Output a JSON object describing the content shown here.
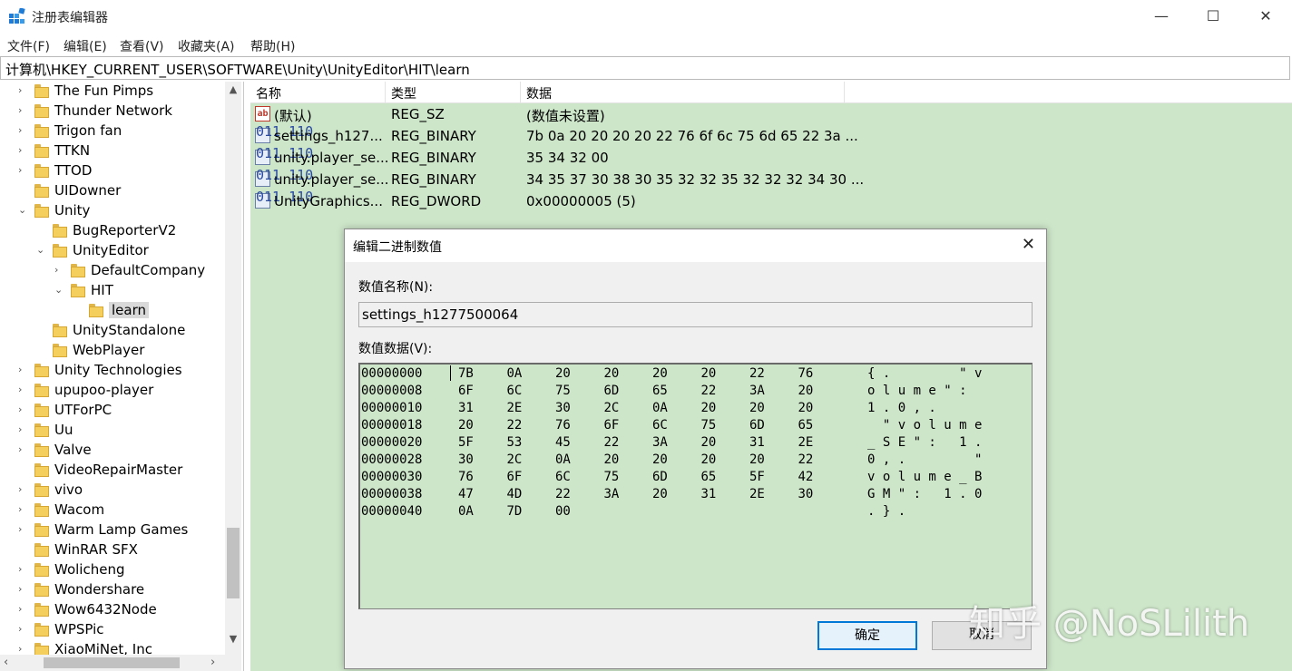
{
  "window": {
    "title": "注册表编辑器",
    "controls": [
      "—",
      "☐",
      "✕"
    ]
  },
  "menu": [
    "文件(F)",
    "编辑(E)",
    "查看(V)",
    "收藏夹(A)",
    "帮助(H)"
  ],
  "address": "计算机\\HKEY_CURRENT_USER\\SOFTWARE\\Unity\\UnityEditor\\HIT\\learn",
  "tree": {
    "items": [
      {
        "label": "The Fun Pimps",
        "depth": 0,
        "expander": "›"
      },
      {
        "label": "Thunder Network",
        "depth": 0,
        "expander": "›"
      },
      {
        "label": "Trigon fan",
        "depth": 0,
        "expander": "›"
      },
      {
        "label": "TTKN",
        "depth": 0,
        "expander": "›"
      },
      {
        "label": "TTOD",
        "depth": 0,
        "expander": "›"
      },
      {
        "label": "UIDowner",
        "depth": 0,
        "expander": ""
      },
      {
        "label": "Unity",
        "depth": 0,
        "expander": "⌄"
      },
      {
        "label": "BugReporterV2",
        "depth": 1,
        "expander": ""
      },
      {
        "label": "UnityEditor",
        "depth": 1,
        "expander": "⌄"
      },
      {
        "label": "DefaultCompany",
        "depth": 2,
        "expander": "›"
      },
      {
        "label": "HIT",
        "depth": 2,
        "expander": "⌄"
      },
      {
        "label": "learn",
        "depth": 3,
        "expander": "",
        "selected": true
      },
      {
        "label": "UnityStandalone",
        "depth": 1,
        "expander": ""
      },
      {
        "label": "WebPlayer",
        "depth": 1,
        "expander": ""
      },
      {
        "label": "Unity Technologies",
        "depth": 0,
        "expander": "›"
      },
      {
        "label": "upupoo-player",
        "depth": 0,
        "expander": "›"
      },
      {
        "label": "UTForPC",
        "depth": 0,
        "expander": "›"
      },
      {
        "label": "Uu",
        "depth": 0,
        "expander": "›"
      },
      {
        "label": "Valve",
        "depth": 0,
        "expander": "›"
      },
      {
        "label": "VideoRepairMaster",
        "depth": 0,
        "expander": ""
      },
      {
        "label": "vivo",
        "depth": 0,
        "expander": "›"
      },
      {
        "label": "Wacom",
        "depth": 0,
        "expander": "›"
      },
      {
        "label": "Warm Lamp Games",
        "depth": 0,
        "expander": "›"
      },
      {
        "label": "WinRAR SFX",
        "depth": 0,
        "expander": ""
      },
      {
        "label": "Wolicheng",
        "depth": 0,
        "expander": "›"
      },
      {
        "label": "Wondershare",
        "depth": 0,
        "expander": "›"
      },
      {
        "label": "Wow6432Node",
        "depth": 0,
        "expander": "›"
      },
      {
        "label": "WPSPic",
        "depth": 0,
        "expander": "›"
      },
      {
        "label": "XiaoMiNet, Inc",
        "depth": 0,
        "expander": "›"
      }
    ]
  },
  "values": {
    "headers": [
      "名称",
      "类型",
      "数据"
    ],
    "rows": [
      {
        "icon": "string-value-icon",
        "name": "(默认)",
        "type": "REG_SZ",
        "data": "(数值未设置)"
      },
      {
        "icon": "binary-value-icon",
        "name": "settings_h127...",
        "type": "REG_BINARY",
        "data": "7b 0a 20 20 20 20 22 76 6f 6c 75 6d 65 22 3a ..."
      },
      {
        "icon": "binary-value-icon",
        "name": "unity.player_se...",
        "type": "REG_BINARY",
        "data": "35 34 32 00"
      },
      {
        "icon": "binary-value-icon",
        "name": "unity.player_se...",
        "type": "REG_BINARY",
        "data": "34 35 37 30 38 30 35 32 32 35 32 32 32 34 30 ..."
      },
      {
        "icon": "binary-value-icon",
        "name": "UnityGraphics...",
        "type": "REG_DWORD",
        "data": "0x00000005 (5)"
      }
    ]
  },
  "dialog": {
    "title": "编辑二进制数值",
    "name_label": "数值名称(N):",
    "name_value": "settings_h1277500064",
    "data_label": "数值数据(V):",
    "hex_rows": [
      {
        "offset": "00000000",
        "bytes": [
          "7B",
          "0A",
          "20",
          "20",
          "20",
          "20",
          "22",
          "76"
        ],
        "ascii": "{ .         \" v"
      },
      {
        "offset": "00000008",
        "bytes": [
          "6F",
          "6C",
          "75",
          "6D",
          "65",
          "22",
          "3A",
          "20"
        ],
        "ascii": "o l u m e \" :"
      },
      {
        "offset": "00000010",
        "bytes": [
          "31",
          "2E",
          "30",
          "2C",
          "0A",
          "20",
          "20",
          "20"
        ],
        "ascii": "1 . 0 , ."
      },
      {
        "offset": "00000018",
        "bytes": [
          "20",
          "22",
          "76",
          "6F",
          "6C",
          "75",
          "6D",
          "65"
        ],
        "ascii": "  \" v o l u m e"
      },
      {
        "offset": "00000020",
        "bytes": [
          "5F",
          "53",
          "45",
          "22",
          "3A",
          "20",
          "31",
          "2E"
        ],
        "ascii": "_ S E \" :   1 ."
      },
      {
        "offset": "00000028",
        "bytes": [
          "30",
          "2C",
          "0A",
          "20",
          "20",
          "20",
          "20",
          "22"
        ],
        "ascii": "0 , .         \""
      },
      {
        "offset": "00000030",
        "bytes": [
          "76",
          "6F",
          "6C",
          "75",
          "6D",
          "65",
          "5F",
          "42"
        ],
        "ascii": "v o l u m e _ B"
      },
      {
        "offset": "00000038",
        "bytes": [
          "47",
          "4D",
          "22",
          "3A",
          "20",
          "31",
          "2E",
          "30"
        ],
        "ascii": "G M \" :   1 . 0"
      },
      {
        "offset": "00000040",
        "bytes": [
          "0A",
          "7D",
          "00"
        ],
        "ascii": ". } ."
      }
    ],
    "ok_label": "确定",
    "cancel_label": "取消"
  },
  "watermark": "知乎 @NoSLilith"
}
